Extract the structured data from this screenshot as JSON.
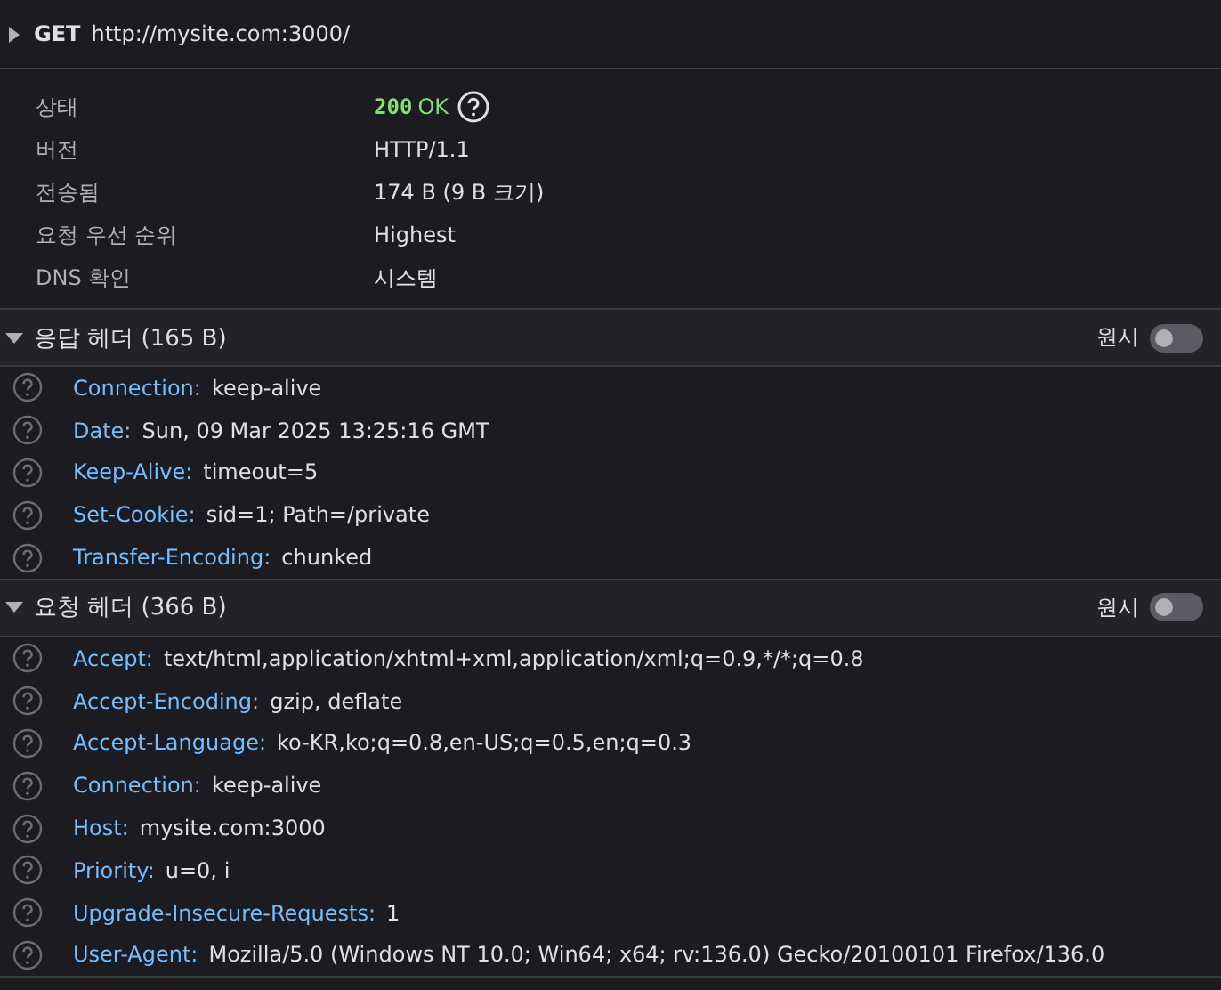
{
  "request": {
    "expanded": false,
    "method": "GET",
    "url": "http://mysite.com:3000/"
  },
  "summary": [
    {
      "label": "상태",
      "kind": "status",
      "code": "200",
      "value": "OK"
    },
    {
      "label": "버전",
      "kind": "text",
      "value": "HTTP/1.1"
    },
    {
      "label": "전송됨",
      "kind": "text",
      "value": "174 B (9 B 크기)"
    },
    {
      "label": "요청 우선 순위",
      "kind": "text",
      "value": "Highest"
    },
    {
      "label": "DNS 확인",
      "kind": "text",
      "value": "시스템"
    }
  ],
  "sections": [
    {
      "title": "응답 헤더 (165 B)",
      "expanded": true,
      "raw_label": "원시",
      "raw_on": false,
      "headers": [
        {
          "name": "Connection:",
          "value": "keep-alive"
        },
        {
          "name": "Date:",
          "value": "Sun, 09 Mar 2025 13:25:16 GMT"
        },
        {
          "name": "Keep-Alive:",
          "value": "timeout=5"
        },
        {
          "name": "Set-Cookie:",
          "value": "sid=1; Path=/private"
        },
        {
          "name": "Transfer-Encoding:",
          "value": "chunked"
        }
      ]
    },
    {
      "title": "요청 헤더 (366 B)",
      "expanded": true,
      "raw_label": "원시",
      "raw_on": false,
      "headers": [
        {
          "name": "Accept:",
          "value": "text/html,application/xhtml+xml,application/xml;q=0.9,*/*;q=0.8"
        },
        {
          "name": "Accept-Encoding:",
          "value": "gzip, deflate"
        },
        {
          "name": "Accept-Language:",
          "value": "ko-KR,ko;q=0.8,en-US;q=0.5,en;q=0.3"
        },
        {
          "name": "Connection:",
          "value": "keep-alive"
        },
        {
          "name": "Host:",
          "value": "mysite.com:3000"
        },
        {
          "name": "Priority:",
          "value": "u=0, i"
        },
        {
          "name": "Upgrade-Insecure-Requests:",
          "value": "1"
        },
        {
          "name": "User-Agent:",
          "value": "Mozilla/5.0 (Windows NT 10.0; Win64; x64; rv:136.0) Gecko/20100101 Firefox/136.0"
        }
      ]
    }
  ]
}
